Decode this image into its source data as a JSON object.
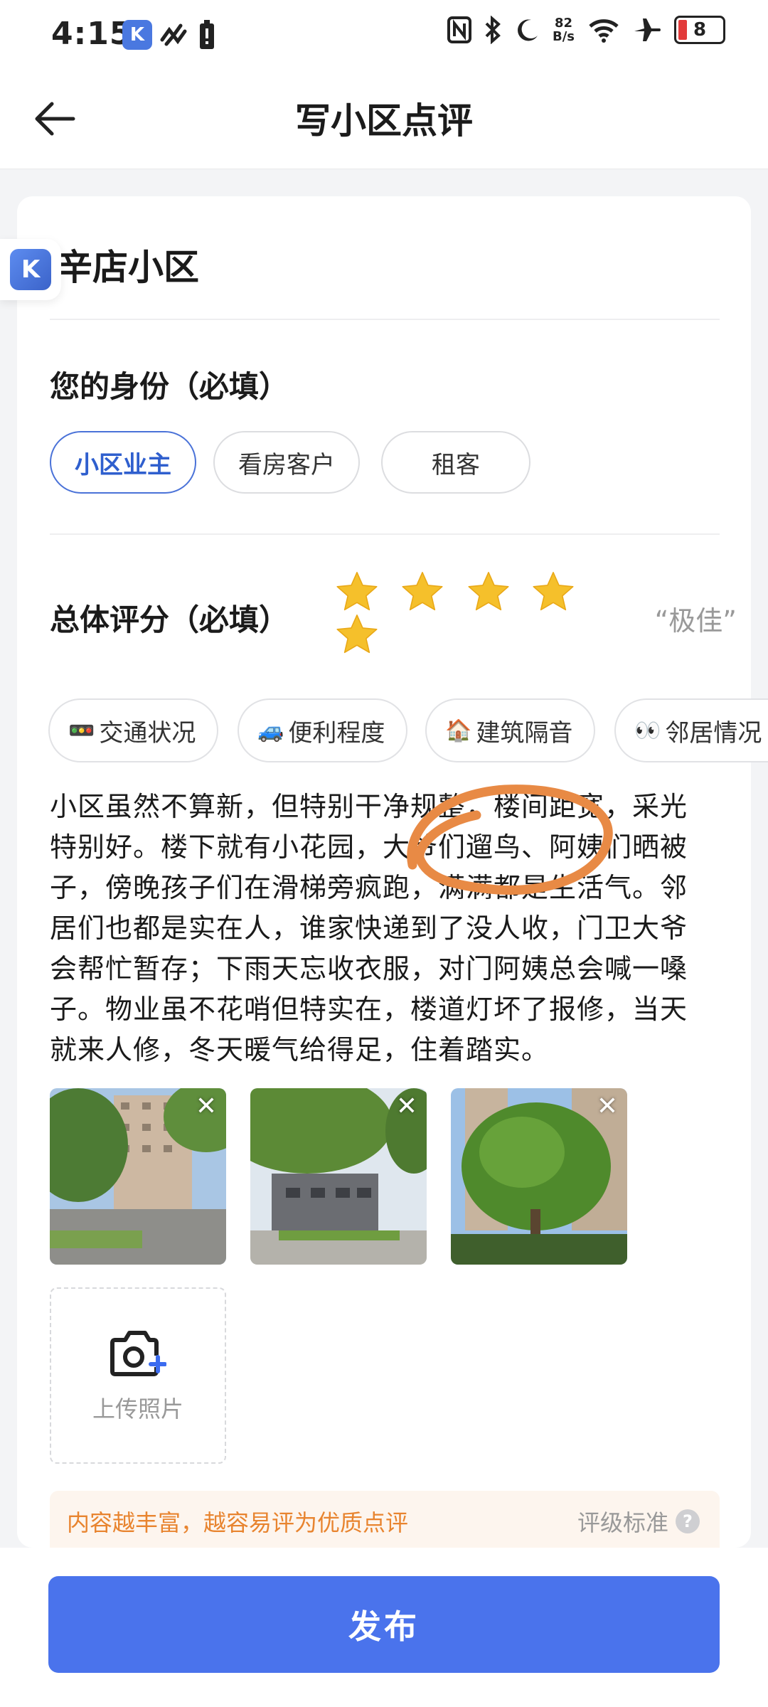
{
  "status_bar": {
    "time": "4:15",
    "app_icon_letter": "K",
    "net_speed_value": "82",
    "net_speed_unit": "B/s",
    "battery": "8"
  },
  "header": {
    "title": "写小区点评",
    "back_icon": "arrow-left-icon"
  },
  "community_name": "辛店小区",
  "identity": {
    "title": "您的身份（必填）",
    "options": [
      "小区业主",
      "看房客户",
      "租客"
    ],
    "selected": "小区业主"
  },
  "rating": {
    "title": "总体评分（必填）",
    "stars": 5,
    "max_stars": 5,
    "label": "“极佳”",
    "star_color": "#f5c02b"
  },
  "tags": [
    {
      "emoji": "🚥",
      "label": "交通状况"
    },
    {
      "emoji": "🚙",
      "label": "便利程度"
    },
    {
      "emoji": "🏠",
      "label": "建筑隔音"
    },
    {
      "emoji": "👀",
      "label": "邻居情况"
    }
  ],
  "review_lines": [
    "小区虽然不算新，但特别干净规整，楼间距宽，采光",
    "特别好。楼下就有小花园，大爷们遛鸟、阿姨们晒被",
    "子，傍晚孩子们在滑梯旁疯跑，满满都是生活气。邻",
    "居们也都是实在人，谁家快递到了没人收，门卫大爷",
    "会帮忙暂存；下雨天忘收衣服，对门阿姨总会喊一嗓",
    "子。物业虽不花哨但特实在，楼道灯坏了报修，当天",
    "就来人修，冬天暖气给得足，住着踏实。"
  ],
  "photos": [
    {
      "name": "photo-1",
      "remove_icon": "close-icon"
    },
    {
      "name": "photo-2",
      "remove_icon": "close-icon"
    },
    {
      "name": "photo-3",
      "remove_icon": "close-icon"
    }
  ],
  "upload": {
    "label": "上传照片",
    "icon": "camera-plus-icon"
  },
  "tip": {
    "text": "内容越丰富，越容易评为优质点评",
    "standard": "评级标准",
    "help_glyph": "?"
  },
  "publish_label": "发布",
  "colors": {
    "accent": "#4a73ec",
    "tip_text": "#e8842f",
    "tip_bg": "#fdf5ee"
  }
}
